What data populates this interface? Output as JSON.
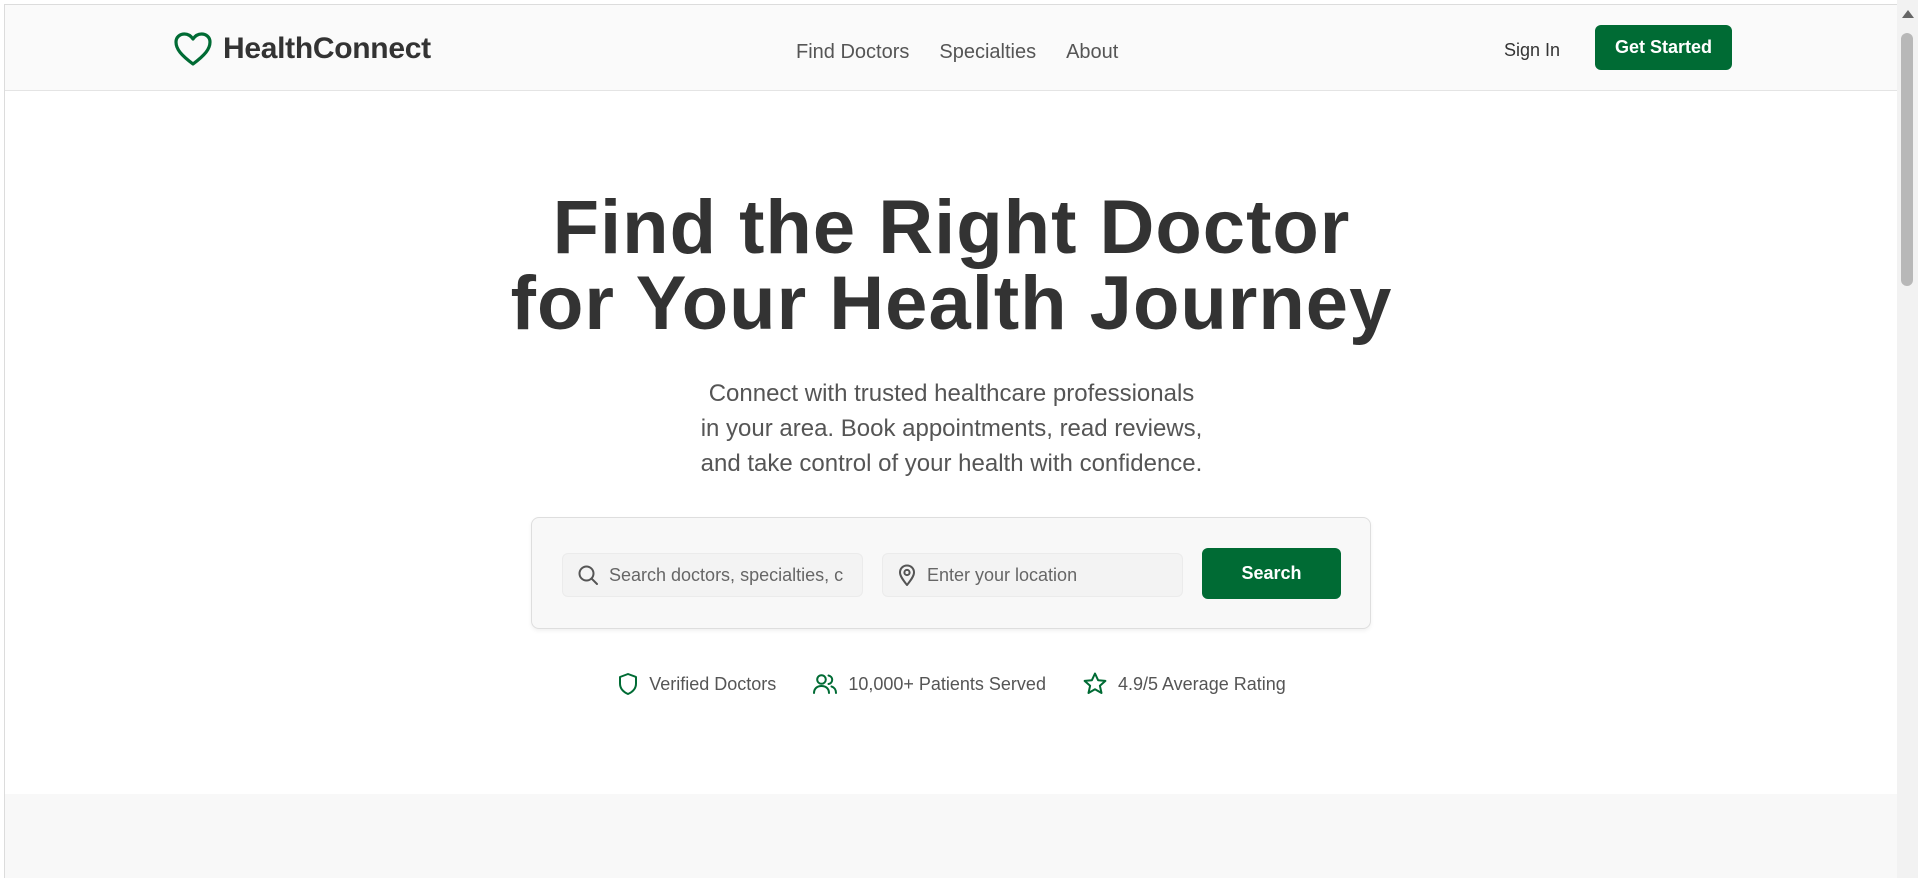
{
  "brand": {
    "name": "HealthConnect",
    "color": "#006b34"
  },
  "nav": {
    "items": [
      {
        "label": "Find Doctors"
      },
      {
        "label": "Specialties"
      },
      {
        "label": "About"
      }
    ]
  },
  "auth": {
    "signin_label": "Sign In",
    "cta_label": "Get Started"
  },
  "hero": {
    "title_lines": [
      "Find the Right Doctor",
      "for Your Health Journey"
    ],
    "subtitle_lines": [
      "Connect with trusted healthcare professionals",
      "in your area. Book appointments, read reviews,",
      "and take control of your health with confidence."
    ]
  },
  "search": {
    "query_placeholder": "Search doctors, specialties, c",
    "query_value": "",
    "location_placeholder": "Enter your location",
    "location_value": "",
    "button_label": "Search"
  },
  "badges": [
    {
      "icon": "shield-icon",
      "label": "Verified Doctors"
    },
    {
      "icon": "users-icon",
      "label": "10,000+ Patients Served"
    },
    {
      "icon": "star-icon",
      "label": "4.9/5 Average Rating"
    }
  ],
  "colors": {
    "accent": "#006b34",
    "text_dark": "#333333",
    "text_muted": "#555555"
  }
}
